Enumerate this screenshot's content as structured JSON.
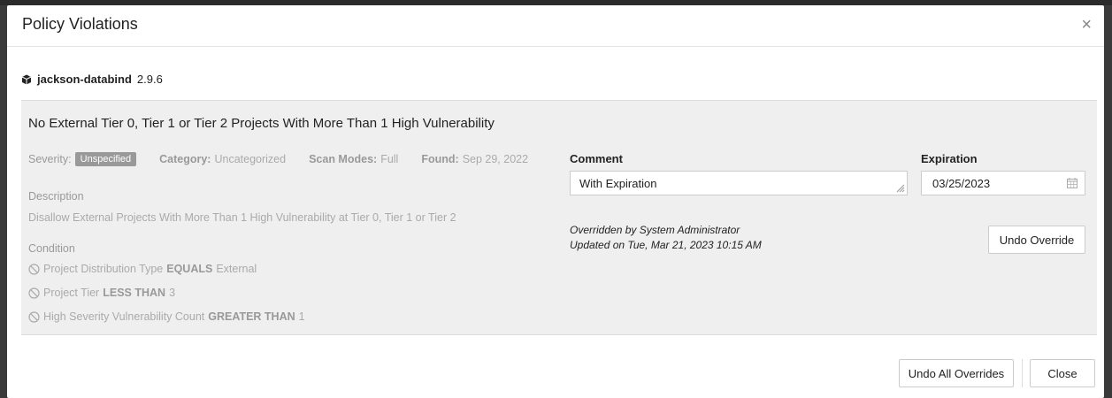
{
  "modal": {
    "title": "Policy Violations",
    "close_glyph": "×"
  },
  "component": {
    "icon": "package-icon",
    "name": "jackson-databind",
    "version": "2.9.6"
  },
  "violation": {
    "title": "No External Tier 0, Tier 1 or Tier 2 Projects With More Than 1 High Vulnerability",
    "severity_label": "Severity:",
    "severity_value": "Unspecified",
    "category_label": "Category:",
    "category_value": "Uncategorized",
    "scan_modes_label": "Scan Modes:",
    "scan_modes_value": "Full",
    "found_label": "Found:",
    "found_value": "Sep 29, 2022",
    "description_label": "Description",
    "description_text": "Disallow External Projects With More Than 1 High Vulnerability at Tier 0, Tier 1 or Tier 2",
    "condition_label": "Condition",
    "conditions": [
      {
        "prefix": "Project Distribution Type",
        "op": "EQUALS",
        "value": "External"
      },
      {
        "prefix": "Project Tier",
        "op": "LESS THAN",
        "value": "3"
      },
      {
        "prefix": "High Severity Vulnerability Count",
        "op": "GREATER THAN",
        "value": "1"
      }
    ]
  },
  "override": {
    "comment_label": "Comment",
    "comment_value": "With Expiration",
    "expiration_label": "Expiration",
    "expiration_value": "03/25/2023",
    "overridden_by": "Overridden by System Administrator",
    "updated_on": "Updated on Tue, Mar 21, 2023 10:15 AM",
    "undo_override_label": "Undo Override"
  },
  "footer": {
    "undo_all_label": "Undo All Overrides",
    "close_label": "Close"
  },
  "colors": {
    "badge_bg": "#999999",
    "panel_bg": "#efefef"
  }
}
